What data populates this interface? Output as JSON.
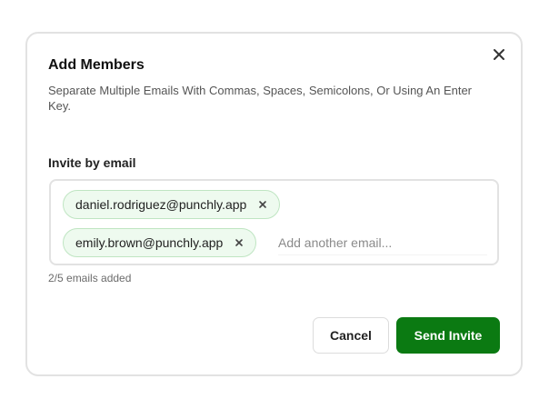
{
  "dialog": {
    "title": "Add Members",
    "subtitle": "Separate Multiple Emails With Commas, Spaces, Semicolons, Or Using An Enter Key.",
    "close_icon": "close-icon"
  },
  "invite": {
    "label": "Invite by email",
    "chips": [
      {
        "email": "daniel.rodriguez@punchly.app",
        "remove_icon": "close-icon"
      },
      {
        "email": "emily.brown@punchly.app",
        "remove_icon": "close-icon"
      }
    ],
    "input_value": "",
    "input_placeholder": "Add another email...",
    "counter": "2/5 emails added"
  },
  "actions": {
    "cancel_label": "Cancel",
    "send_label": "Send Invite"
  },
  "colors": {
    "primary": "#0b7a12",
    "chip_background": "#eefaef",
    "chip_border": "#bfe5c2",
    "border": "#e2e2e2"
  }
}
